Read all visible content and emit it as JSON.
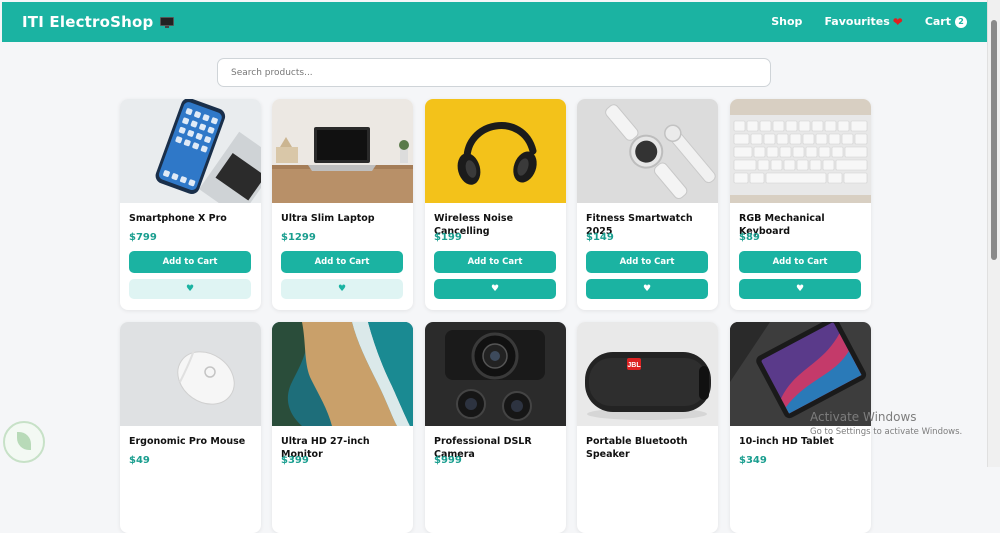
{
  "navbar": {
    "brand": "ITI ElectroShop",
    "links": [
      {
        "label": "Shop"
      },
      {
        "label": "Favourites"
      },
      {
        "label": "Cart"
      }
    ],
    "cart_count": "2"
  },
  "search": {
    "placeholder": "Search products...",
    "value": ""
  },
  "products": [
    {
      "name": "Smartphone X Pro",
      "price": "$799",
      "add_label": "Add to Cart",
      "fav_symbol": "♥"
    },
    {
      "name": "Ultra Slim Laptop",
      "price": "$1299",
      "add_label": "Add to Cart",
      "fav_symbol": "♥"
    },
    {
      "name": "Wireless Noise Cancelling",
      "price": "$199",
      "add_label": "Add to Cart",
      "fav_symbol": "♥"
    },
    {
      "name": "Fitness Smartwatch 2025",
      "price": "$149",
      "add_label": "Add to Cart",
      "fav_symbol": "♥"
    },
    {
      "name": "RGB Mechanical Keyboard",
      "price": "$89",
      "add_label": "Add to Cart",
      "fav_symbol": "♥"
    },
    {
      "name": "Ergonomic Pro Mouse",
      "price": "$49"
    },
    {
      "name": "Ultra HD 27-inch Monitor",
      "price": "$399"
    },
    {
      "name": "Professional DSLR Camera",
      "price": "$999"
    },
    {
      "name": "Portable Bluetooth Speaker",
      "price": ""
    },
    {
      "name": "10-inch HD Tablet",
      "price": "$349"
    }
  ],
  "watermark": {
    "title": "Activate Windows",
    "subtitle": "Go to Settings to activate Windows."
  },
  "colors": {
    "accent": "#1bb3a2",
    "price": "#1a9e8f",
    "fav_light": "#dff4f3",
    "heart": "#e02020"
  }
}
